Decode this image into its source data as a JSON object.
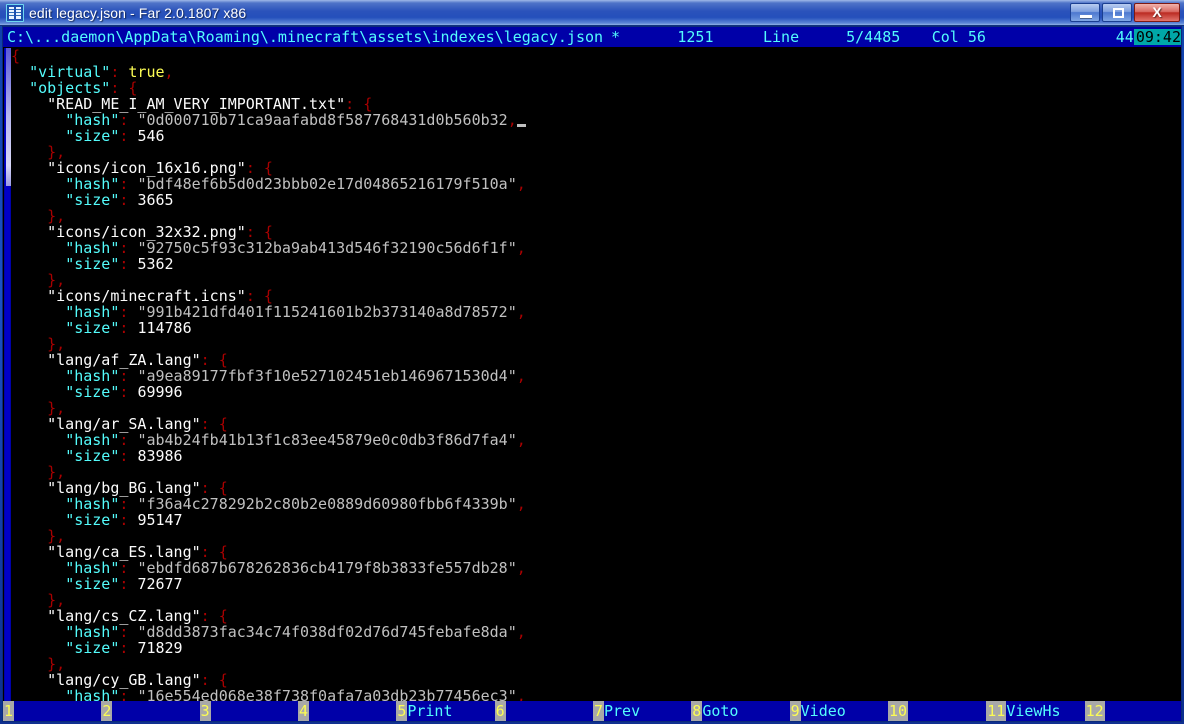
{
  "window": {
    "title": "edit legacy.json - Far 2.0.1807 x86",
    "icon": "far-editor-icon",
    "minimize_label": "–",
    "maximize_label": "",
    "close_label": "X"
  },
  "status": {
    "path": "C:\\...daemon\\AppData\\Roaming\\.minecraft\\assets\\indexes\\legacy.json",
    "modified_flag": "*",
    "file_size": "1251",
    "line_label": "Line",
    "line_position": "5/4485",
    "column": "Col 56",
    "extra": "44",
    "clock": "09:42"
  },
  "editor": {
    "cursor_line": 5,
    "cursor_col": 56,
    "lines": [
      [
        {
          "t": "{",
          "c": "brace"
        }
      ],
      [
        {
          "t": "  ",
          "c": "plain"
        },
        {
          "t": "\"virtual\"",
          "c": "ckey"
        },
        {
          "t": ": ",
          "c": "punct"
        },
        {
          "t": "true",
          "c": "bool"
        },
        {
          "t": ",",
          "c": "punct"
        }
      ],
      [
        {
          "t": "  ",
          "c": "plain"
        },
        {
          "t": "\"objects\"",
          "c": "ckey"
        },
        {
          "t": ": ",
          "c": "punct"
        },
        {
          "t": "{",
          "c": "brace"
        }
      ],
      [
        {
          "t": "    ",
          "c": "plain"
        },
        {
          "t": "\"READ_ME_I_AM_VERY_IMPORTANT.txt\"",
          "c": "key"
        },
        {
          "t": ": ",
          "c": "punct"
        },
        {
          "t": "{",
          "c": "brace"
        }
      ],
      [
        {
          "t": "      ",
          "c": "plain"
        },
        {
          "t": "\"hash\"",
          "c": "ckey"
        },
        {
          "t": ": ",
          "c": "punct"
        },
        {
          "t": "\"0d000710b71ca9aafabd8f587768431d0b560b32",
          "c": "str"
        },
        {
          "t": ",",
          "c": "punct"
        },
        {
          "t": "CURSOR",
          "c": "cursor"
        }
      ],
      [
        {
          "t": "      ",
          "c": "plain"
        },
        {
          "t": "\"size\"",
          "c": "ckey"
        },
        {
          "t": ": ",
          "c": "punct"
        },
        {
          "t": "546",
          "c": "num"
        }
      ],
      [
        {
          "t": "    ",
          "c": "plain"
        },
        {
          "t": "}",
          "c": "brace"
        },
        {
          "t": ",",
          "c": "punct"
        }
      ],
      [
        {
          "t": "    ",
          "c": "plain"
        },
        {
          "t": "\"icons/icon_16x16.png\"",
          "c": "key"
        },
        {
          "t": ": ",
          "c": "punct"
        },
        {
          "t": "{",
          "c": "brace"
        }
      ],
      [
        {
          "t": "      ",
          "c": "plain"
        },
        {
          "t": "\"hash\"",
          "c": "ckey"
        },
        {
          "t": ": ",
          "c": "punct"
        },
        {
          "t": "\"bdf48ef6b5d0d23bbb02e17d04865216179f510a\"",
          "c": "str"
        },
        {
          "t": ",",
          "c": "punct"
        }
      ],
      [
        {
          "t": "      ",
          "c": "plain"
        },
        {
          "t": "\"size\"",
          "c": "ckey"
        },
        {
          "t": ": ",
          "c": "punct"
        },
        {
          "t": "3665",
          "c": "num"
        }
      ],
      [
        {
          "t": "    ",
          "c": "plain"
        },
        {
          "t": "}",
          "c": "brace"
        },
        {
          "t": ",",
          "c": "punct"
        }
      ],
      [
        {
          "t": "    ",
          "c": "plain"
        },
        {
          "t": "\"icons/icon_32x32.png\"",
          "c": "key"
        },
        {
          "t": ": ",
          "c": "punct"
        },
        {
          "t": "{",
          "c": "brace"
        }
      ],
      [
        {
          "t": "      ",
          "c": "plain"
        },
        {
          "t": "\"hash\"",
          "c": "ckey"
        },
        {
          "t": ": ",
          "c": "punct"
        },
        {
          "t": "\"92750c5f93c312ba9ab413d546f32190c56d6f1f\"",
          "c": "str"
        },
        {
          "t": ",",
          "c": "punct"
        }
      ],
      [
        {
          "t": "      ",
          "c": "plain"
        },
        {
          "t": "\"size\"",
          "c": "ckey"
        },
        {
          "t": ": ",
          "c": "punct"
        },
        {
          "t": "5362",
          "c": "num"
        }
      ],
      [
        {
          "t": "    ",
          "c": "plain"
        },
        {
          "t": "}",
          "c": "brace"
        },
        {
          "t": ",",
          "c": "punct"
        }
      ],
      [
        {
          "t": "    ",
          "c": "plain"
        },
        {
          "t": "\"icons/minecraft.icns\"",
          "c": "key"
        },
        {
          "t": ": ",
          "c": "punct"
        },
        {
          "t": "{",
          "c": "brace"
        }
      ],
      [
        {
          "t": "      ",
          "c": "plain"
        },
        {
          "t": "\"hash\"",
          "c": "ckey"
        },
        {
          "t": ": ",
          "c": "punct"
        },
        {
          "t": "\"991b421dfd401f115241601b2b373140a8d78572\"",
          "c": "str"
        },
        {
          "t": ",",
          "c": "punct"
        }
      ],
      [
        {
          "t": "      ",
          "c": "plain"
        },
        {
          "t": "\"size\"",
          "c": "ckey"
        },
        {
          "t": ": ",
          "c": "punct"
        },
        {
          "t": "114786",
          "c": "num"
        }
      ],
      [
        {
          "t": "    ",
          "c": "plain"
        },
        {
          "t": "}",
          "c": "brace"
        },
        {
          "t": ",",
          "c": "punct"
        }
      ],
      [
        {
          "t": "    ",
          "c": "plain"
        },
        {
          "t": "\"lang/af_ZA.lang\"",
          "c": "key"
        },
        {
          "t": ": ",
          "c": "punct"
        },
        {
          "t": "{",
          "c": "brace"
        }
      ],
      [
        {
          "t": "      ",
          "c": "plain"
        },
        {
          "t": "\"hash\"",
          "c": "ckey"
        },
        {
          "t": ": ",
          "c": "punct"
        },
        {
          "t": "\"a9ea89177fbf3f10e527102451eb1469671530d4\"",
          "c": "str"
        },
        {
          "t": ",",
          "c": "punct"
        }
      ],
      [
        {
          "t": "      ",
          "c": "plain"
        },
        {
          "t": "\"size\"",
          "c": "ckey"
        },
        {
          "t": ": ",
          "c": "punct"
        },
        {
          "t": "69996",
          "c": "num"
        }
      ],
      [
        {
          "t": "    ",
          "c": "plain"
        },
        {
          "t": "}",
          "c": "brace"
        },
        {
          "t": ",",
          "c": "punct"
        }
      ],
      [
        {
          "t": "    ",
          "c": "plain"
        },
        {
          "t": "\"lang/ar_SA.lang\"",
          "c": "key"
        },
        {
          "t": ": ",
          "c": "punct"
        },
        {
          "t": "{",
          "c": "brace"
        }
      ],
      [
        {
          "t": "      ",
          "c": "plain"
        },
        {
          "t": "\"hash\"",
          "c": "ckey"
        },
        {
          "t": ": ",
          "c": "punct"
        },
        {
          "t": "\"ab4b24fb41b13f1c83ee45879e0c0db3f86d7fa4\"",
          "c": "str"
        },
        {
          "t": ",",
          "c": "punct"
        }
      ],
      [
        {
          "t": "      ",
          "c": "plain"
        },
        {
          "t": "\"size\"",
          "c": "ckey"
        },
        {
          "t": ": ",
          "c": "punct"
        },
        {
          "t": "83986",
          "c": "num"
        }
      ],
      [
        {
          "t": "    ",
          "c": "plain"
        },
        {
          "t": "}",
          "c": "brace"
        },
        {
          "t": ",",
          "c": "punct"
        }
      ],
      [
        {
          "t": "    ",
          "c": "plain"
        },
        {
          "t": "\"lang/bg_BG.lang\"",
          "c": "key"
        },
        {
          "t": ": ",
          "c": "punct"
        },
        {
          "t": "{",
          "c": "brace"
        }
      ],
      [
        {
          "t": "      ",
          "c": "plain"
        },
        {
          "t": "\"hash\"",
          "c": "ckey"
        },
        {
          "t": ": ",
          "c": "punct"
        },
        {
          "t": "\"f36a4c278292b2c80b2e0889d60980fbb6f4339b\"",
          "c": "str"
        },
        {
          "t": ",",
          "c": "punct"
        }
      ],
      [
        {
          "t": "      ",
          "c": "plain"
        },
        {
          "t": "\"size\"",
          "c": "ckey"
        },
        {
          "t": ": ",
          "c": "punct"
        },
        {
          "t": "95147",
          "c": "num"
        }
      ],
      [
        {
          "t": "    ",
          "c": "plain"
        },
        {
          "t": "}",
          "c": "brace"
        },
        {
          "t": ",",
          "c": "punct"
        }
      ],
      [
        {
          "t": "    ",
          "c": "plain"
        },
        {
          "t": "\"lang/ca_ES.lang\"",
          "c": "key"
        },
        {
          "t": ": ",
          "c": "punct"
        },
        {
          "t": "{",
          "c": "brace"
        }
      ],
      [
        {
          "t": "      ",
          "c": "plain"
        },
        {
          "t": "\"hash\"",
          "c": "ckey"
        },
        {
          "t": ": ",
          "c": "punct"
        },
        {
          "t": "\"ebdfd687b678262836cb4179f8b3833fe557db28\"",
          "c": "str"
        },
        {
          "t": ",",
          "c": "punct"
        }
      ],
      [
        {
          "t": "      ",
          "c": "plain"
        },
        {
          "t": "\"size\"",
          "c": "ckey"
        },
        {
          "t": ": ",
          "c": "punct"
        },
        {
          "t": "72677",
          "c": "num"
        }
      ],
      [
        {
          "t": "    ",
          "c": "plain"
        },
        {
          "t": "}",
          "c": "brace"
        },
        {
          "t": ",",
          "c": "punct"
        }
      ],
      [
        {
          "t": "    ",
          "c": "plain"
        },
        {
          "t": "\"lang/cs_CZ.lang\"",
          "c": "key"
        },
        {
          "t": ": ",
          "c": "punct"
        },
        {
          "t": "{",
          "c": "brace"
        }
      ],
      [
        {
          "t": "      ",
          "c": "plain"
        },
        {
          "t": "\"hash\"",
          "c": "ckey"
        },
        {
          "t": ": ",
          "c": "punct"
        },
        {
          "t": "\"d8dd3873fac34c74f038df02d76d745febafe8da\"",
          "c": "str"
        },
        {
          "t": ",",
          "c": "punct"
        }
      ],
      [
        {
          "t": "      ",
          "c": "plain"
        },
        {
          "t": "\"size\"",
          "c": "ckey"
        },
        {
          "t": ": ",
          "c": "punct"
        },
        {
          "t": "71829",
          "c": "num"
        }
      ],
      [
        {
          "t": "    ",
          "c": "plain"
        },
        {
          "t": "}",
          "c": "brace"
        },
        {
          "t": ",",
          "c": "punct"
        }
      ],
      [
        {
          "t": "    ",
          "c": "plain"
        },
        {
          "t": "\"lang/cy_GB.lang\"",
          "c": "key"
        },
        {
          "t": ": ",
          "c": "punct"
        },
        {
          "t": "{",
          "c": "brace"
        }
      ],
      [
        {
          "t": "      ",
          "c": "plain"
        },
        {
          "t": "\"hash\"",
          "c": "ckey"
        },
        {
          "t": ": ",
          "c": "punct"
        },
        {
          "t": "\"16e554ed068e38f738f0afa7a03db23b77456ec3\"",
          "c": "str"
        },
        {
          "t": ",",
          "c": "punct"
        }
      ]
    ]
  },
  "scrollbar": {
    "thumb_top_pct": 0,
    "thumb_height_pct": 21
  },
  "function_keys": [
    {
      "num": "1",
      "label": ""
    },
    {
      "num": "2",
      "label": ""
    },
    {
      "num": "3",
      "label": ""
    },
    {
      "num": "4",
      "label": ""
    },
    {
      "num": "5",
      "label": "Print"
    },
    {
      "num": "6",
      "label": ""
    },
    {
      "num": "7",
      "label": "Prev"
    },
    {
      "num": "8",
      "label": "Goto"
    },
    {
      "num": "9",
      "label": "Video"
    },
    {
      "num": "10",
      "label": ""
    },
    {
      "num": "11",
      "label": "ViewHs"
    },
    {
      "num": "12",
      "label": ""
    }
  ],
  "colors": {
    "console_bg": "#000000",
    "status_bg": "#0000a8",
    "status_fg": "#54fcfc",
    "clock_bg": "#00a8a8",
    "key_cyan": "#54fcfc",
    "key_white": "#fcfcfc",
    "string_gray": "#c0c0c0",
    "punct_red": "#a80000",
    "bool_yellow": "#fcfc54",
    "fkey_num_bg": "#a8a8a8",
    "fkey_num_fg": "#fcfc54",
    "title_blue": "#2450bb"
  }
}
